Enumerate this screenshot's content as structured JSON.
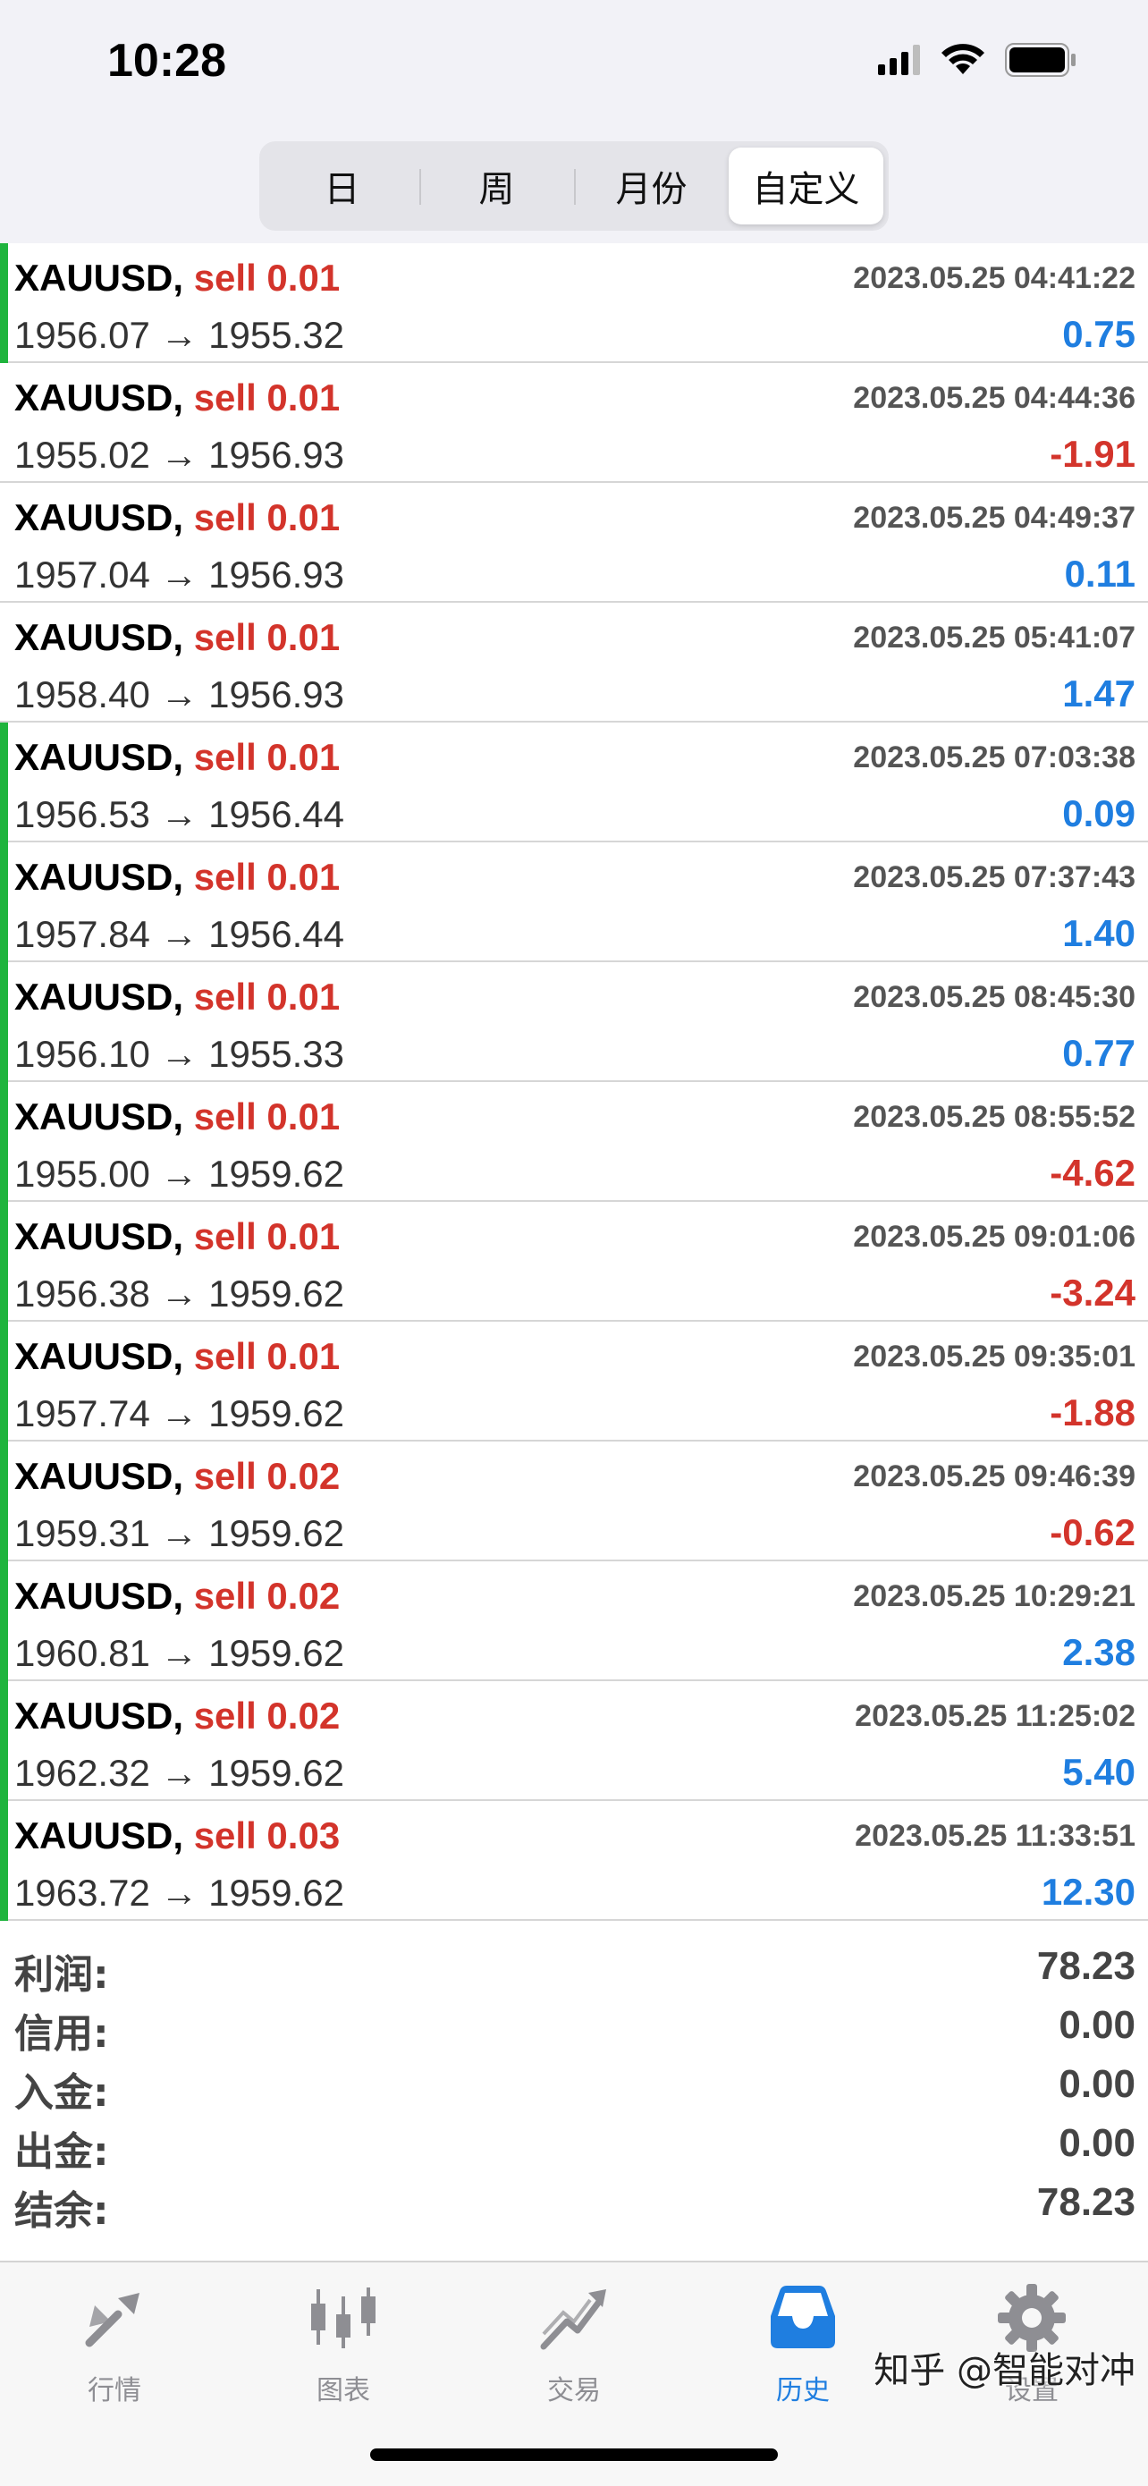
{
  "status_bar": {
    "time": "10:28"
  },
  "segments": [
    {
      "label": "日",
      "active": false
    },
    {
      "label": "周",
      "active": false
    },
    {
      "label": "月份",
      "active": false
    },
    {
      "label": "自定义",
      "active": true
    }
  ],
  "deals": [
    {
      "symbol": "XAUUSD,",
      "type": "sell 0.01",
      "open": "1956.07",
      "close": "1955.32",
      "arrow": "→",
      "time": "2023.05.25 04:41:22",
      "profit": "0.75",
      "sign": "pos",
      "bar": true
    },
    {
      "symbol": "XAUUSD,",
      "type": "sell 0.01",
      "open": "1955.02",
      "close": "1956.93",
      "arrow": "→",
      "time": "2023.05.25 04:44:36",
      "profit": "-1.91",
      "sign": "neg",
      "bar": false
    },
    {
      "symbol": "XAUUSD,",
      "type": "sell 0.01",
      "open": "1957.04",
      "close": "1956.93",
      "arrow": "→",
      "time": "2023.05.25 04:49:37",
      "profit": "0.11",
      "sign": "pos",
      "bar": false
    },
    {
      "symbol": "XAUUSD,",
      "type": "sell 0.01",
      "open": "1958.40",
      "close": "1956.93",
      "arrow": "→",
      "time": "2023.05.25 05:41:07",
      "profit": "1.47",
      "sign": "pos",
      "bar": false
    },
    {
      "symbol": "XAUUSD,",
      "type": "sell 0.01",
      "open": "1956.53",
      "close": "1956.44",
      "arrow": "→",
      "time": "2023.05.25 07:03:38",
      "profit": "0.09",
      "sign": "pos",
      "bar": true
    },
    {
      "symbol": "XAUUSD,",
      "type": "sell 0.01",
      "open": "1957.84",
      "close": "1956.44",
      "arrow": "→",
      "time": "2023.05.25 07:37:43",
      "profit": "1.40",
      "sign": "pos",
      "bar": true
    },
    {
      "symbol": "XAUUSD,",
      "type": "sell 0.01",
      "open": "1956.10",
      "close": "1955.33",
      "arrow": "→",
      "time": "2023.05.25 08:45:30",
      "profit": "0.77",
      "sign": "pos",
      "bar": true
    },
    {
      "symbol": "XAUUSD,",
      "type": "sell 0.01",
      "open": "1955.00",
      "close": "1959.62",
      "arrow": "→",
      "time": "2023.05.25 08:55:52",
      "profit": "-4.62",
      "sign": "neg",
      "bar": true
    },
    {
      "symbol": "XAUUSD,",
      "type": "sell 0.01",
      "open": "1956.38",
      "close": "1959.62",
      "arrow": "→",
      "time": "2023.05.25 09:01:06",
      "profit": "-3.24",
      "sign": "neg",
      "bar": true
    },
    {
      "symbol": "XAUUSD,",
      "type": "sell 0.01",
      "open": "1957.74",
      "close": "1959.62",
      "arrow": "→",
      "time": "2023.05.25 09:35:01",
      "profit": "-1.88",
      "sign": "neg",
      "bar": true
    },
    {
      "symbol": "XAUUSD,",
      "type": "sell 0.02",
      "open": "1959.31",
      "close": "1959.62",
      "arrow": "→",
      "time": "2023.05.25 09:46:39",
      "profit": "-0.62",
      "sign": "neg",
      "bar": true
    },
    {
      "symbol": "XAUUSD,",
      "type": "sell 0.02",
      "open": "1960.81",
      "close": "1959.62",
      "arrow": "→",
      "time": "2023.05.25 10:29:21",
      "profit": "2.38",
      "sign": "pos",
      "bar": true
    },
    {
      "symbol": "XAUUSD,",
      "type": "sell 0.02",
      "open": "1962.32",
      "close": "1959.62",
      "arrow": "→",
      "time": "2023.05.25 11:25:02",
      "profit": "5.40",
      "sign": "pos",
      "bar": true
    },
    {
      "symbol": "XAUUSD,",
      "type": "sell 0.03",
      "open": "1963.72",
      "close": "1959.62",
      "arrow": "→",
      "time": "2023.05.25 11:33:51",
      "profit": "12.30",
      "sign": "pos",
      "bar": true
    }
  ],
  "summary": {
    "profit_label": "利润:",
    "profit_value": "78.23",
    "credit_label": "信用:",
    "credit_value": "0.00",
    "deposit_label": "入金:",
    "deposit_value": "0.00",
    "withdrawal_label": "出金:",
    "withdrawal_value": "0.00",
    "balance_label": "结余:",
    "balance_value": "78.23"
  },
  "tabs": [
    {
      "label": "行情",
      "icon": "quotes-icon",
      "active": false
    },
    {
      "label": "图表",
      "icon": "chart-icon",
      "active": false
    },
    {
      "label": "交易",
      "icon": "trade-icon",
      "active": false
    },
    {
      "label": "历史",
      "icon": "history-icon",
      "active": true
    },
    {
      "label": "设置",
      "icon": "settings-icon",
      "active": false
    }
  ],
  "watermark": "知乎 @智能对冲",
  "colors": {
    "buy_bar": "#1fb43d",
    "positive": "#1f7ee0",
    "negative": "#d3342b",
    "accent": "#1f7ee0"
  }
}
